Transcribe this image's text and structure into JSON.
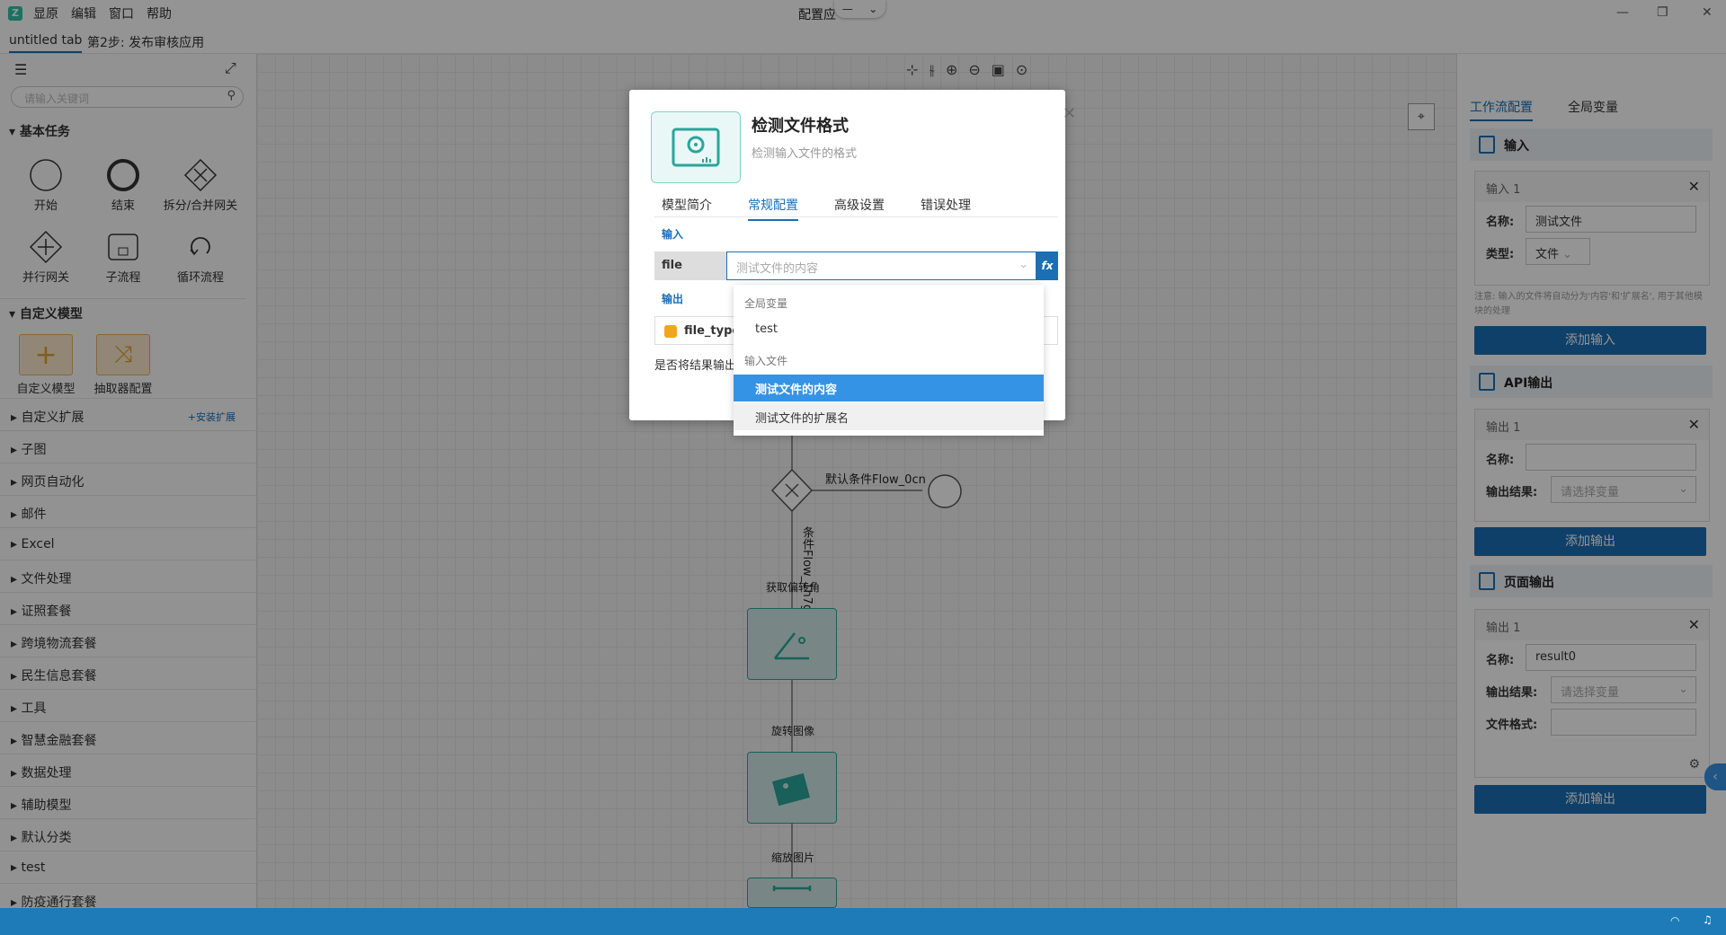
{
  "menu": {
    "items": [
      "显原",
      "编辑",
      "窗口",
      "帮助"
    ]
  },
  "window": {
    "title": "配置应"
  },
  "tabs": [
    {
      "label": "untitled tab"
    },
    {
      "label": "第2步: 发布审核应用"
    }
  ],
  "sidebar": {
    "search_placeholder": "请输入关键词",
    "basic_title": "基本任务",
    "basic_nodes": [
      {
        "label": "开始",
        "icon": "circle-start-icon"
      },
      {
        "label": "结束",
        "icon": "circle-end-icon"
      },
      {
        "label": "拆分/合并网关",
        "icon": "exclusive-gateway-icon"
      },
      {
        "label": "并行网关",
        "icon": "parallel-gateway-icon"
      },
      {
        "label": "子流程",
        "icon": "subprocess-icon"
      },
      {
        "label": "循环流程",
        "icon": "loop-icon"
      }
    ],
    "custom_title": "自定义模型",
    "custom_nodes": [
      {
        "label": "自定义模型",
        "icon": "plus-icon"
      },
      {
        "label": "抽取器配置",
        "icon": "shuffle-icon"
      }
    ],
    "install_link": "+安装扩展",
    "categories": [
      "自定义扩展",
      "子图",
      "网页自动化",
      "邮件",
      "Excel",
      "文件处理",
      "证照套餐",
      "跨境物流套餐",
      "民生信息套餐",
      "工具",
      "智慧金融套餐",
      "数据处理",
      "辅助模型",
      "默认分类",
      "test",
      "防疫通行套餐"
    ]
  },
  "canvas": {
    "flow_labels": {
      "default_flow": "默认条件Flow_0cn",
      "cond_flow": "条件Flow_1h7g",
      "get_angle": "获取偏转角",
      "rotate": "旋转图像",
      "scale": "缩放图片"
    }
  },
  "right_panel": {
    "tabs": [
      "工作流配置",
      "全局变量"
    ],
    "input_section": "输入",
    "input_card": {
      "title": "输入 1",
      "name_label": "名称:",
      "name_value": "测试文件",
      "type_label": "类型:",
      "type_value": "文件"
    },
    "note": "注意: 输入的文件将自动分为'内容'和'扩展名', 用于其他模块的处理",
    "add_input": "添加输入",
    "api_section": "API输出",
    "api_card": {
      "title": "输出 1",
      "name_label": "名称:",
      "name_value": "",
      "result_label": "输出结果:",
      "result_placeholder": "请选择变量"
    },
    "add_output": "添加输出",
    "page_section": "页面输出",
    "page_card": {
      "title": "输出 1",
      "name_label": "名称:",
      "name_value": "result0",
      "result_label": "输出结果:",
      "result_placeholder": "请选择变量",
      "format_label": "文件格式:",
      "format_value": ""
    },
    "add_output2": "添加输出"
  },
  "dialog": {
    "title": "检测文件格式",
    "subtitle": "检测输入文件的格式",
    "tabs": [
      "模型简介",
      "常规配置",
      "高级设置",
      "错误处理"
    ],
    "active_tab": 1,
    "input_label": "输入",
    "file_param": "file",
    "file_placeholder": "测试文件的内容",
    "fx": "fx",
    "output_label": "输出",
    "output_param": "file_type",
    "save_text": "是否将结果输出"
  },
  "dropdown": {
    "group1": "全局变量",
    "opt_test": "test",
    "group2": "输入文件",
    "opt_content": "测试文件的内容",
    "opt_ext": "测试文件的扩展名"
  },
  "colors": {
    "accent": "#1a6fb5",
    "teal": "#2aa59a",
    "status": "#1f7ab8"
  }
}
